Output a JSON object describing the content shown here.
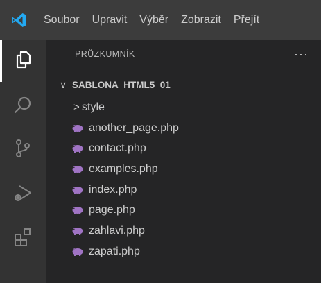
{
  "menu": {
    "items": [
      "Soubor",
      "Upravit",
      "Výběr",
      "Zobrazit",
      "Přejít"
    ]
  },
  "activity_bar": {
    "items": [
      {
        "icon": "explorer-files-icon",
        "active": true
      },
      {
        "icon": "search-icon",
        "active": false
      },
      {
        "icon": "source-control-icon",
        "active": false
      },
      {
        "icon": "run-debug-icon",
        "active": false
      },
      {
        "icon": "extensions-icon",
        "active": false
      }
    ]
  },
  "sidebar": {
    "title": "PRŮZKUMNÍK",
    "more": "···",
    "folder": {
      "chevron": "∨",
      "name": "SABLONA_HTML5_01"
    },
    "subfolder": {
      "chevron": ">",
      "name": "style"
    },
    "files": [
      "another_page.php",
      "contact.php",
      "examples.php",
      "index.php",
      "page.php",
      "zahlavi.php",
      "zapati.php"
    ]
  },
  "colors": {
    "titlebar": "#3c3c3c",
    "activitybar": "#333333",
    "sidebar": "#252526",
    "text": "#cccccc",
    "php_icon": "#a074c4",
    "vscode_blue": "#23a9f2"
  }
}
